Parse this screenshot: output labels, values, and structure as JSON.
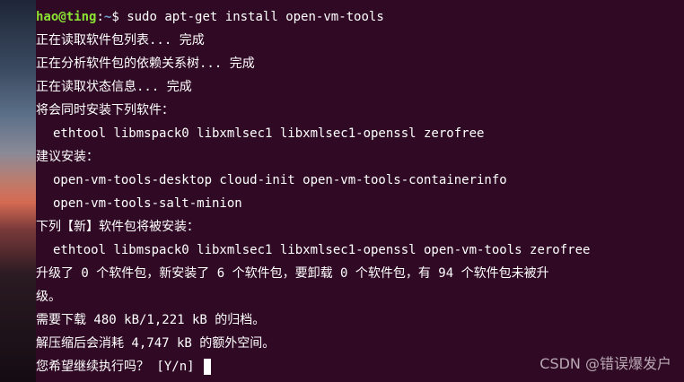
{
  "prompt": {
    "user_host": "hao@ting",
    "separator": ":",
    "path": "~",
    "symbol": "$",
    "command": "sudo apt-get install open-vm-tools"
  },
  "output_lines": [
    "正在读取软件包列表... 完成",
    "正在分析软件包的依赖关系树... 完成",
    "正在读取状态信息... 完成",
    "将会同时安装下列软件：",
    "ethtool libmspack0 libxmlsec1 libxmlsec1-openssl zerofree",
    "建议安装：",
    "open-vm-tools-desktop cloud-init open-vm-tools-containerinfo",
    "open-vm-tools-salt-minion",
    "下列【新】软件包将被安装：",
    "ethtool libmspack0 libxmlsec1 libxmlsec1-openssl open-vm-tools zerofree",
    "升级了 0 个软件包，新安装了 6 个软件包，要卸载 0 个软件包，有 94 个软件包未被升",
    "级。",
    "需要下载 480 kB/1,221 kB 的归档。",
    "解压缩后会消耗 4,747 kB 的额外空间。"
  ],
  "confirm_prompt": "您希望继续执行吗？ [Y/n] ",
  "watermark": "CSDN @错误爆发户",
  "colors": {
    "background": "#300a24",
    "user_host": "#8ae234",
    "path": "#729fcf",
    "text": "#ffffff"
  }
}
